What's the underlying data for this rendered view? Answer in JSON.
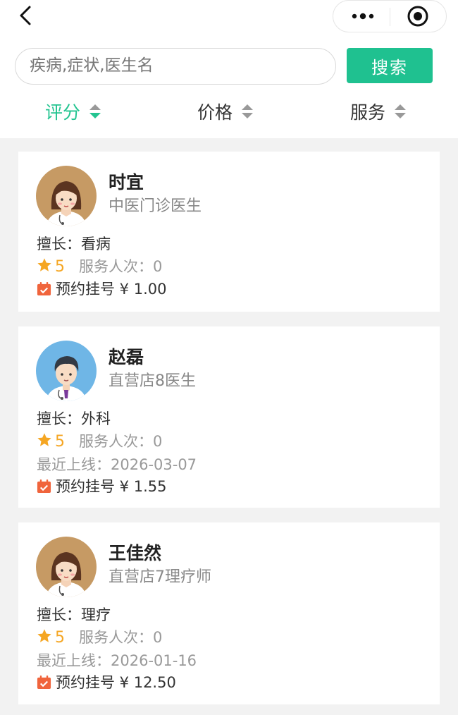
{
  "search": {
    "placeholder": "疾病,症状,医生名",
    "button": "搜索"
  },
  "sort": [
    {
      "label": "评分"
    },
    {
      "label": "价格"
    },
    {
      "label": "服务"
    }
  ],
  "doctors": [
    {
      "name": "时宜",
      "title": "中医门诊医生",
      "specialty": "擅长：看病",
      "score": "5",
      "services": "服务人次：0",
      "last_online": "",
      "booking": "预约挂号 ¥ 1.00"
    },
    {
      "name": "赵磊",
      "title": "直营店8医生",
      "specialty": "擅长：外科",
      "score": "5",
      "services": "服务人次：0",
      "last_online": "最近上线：2026-03-07",
      "booking": "预约挂号 ¥ 1.55"
    },
    {
      "name": "王佳然",
      "title": "直营店7理疗师",
      "specialty": "擅长：理疗",
      "score": "5",
      "services": "服务人次：0",
      "last_online": "最近上线：2026-01-16",
      "booking": "预约挂号 ¥ 12.50"
    }
  ],
  "colors": {
    "accent": "#1fc190",
    "star": "#f5a623",
    "calendar": "#f0643c"
  }
}
